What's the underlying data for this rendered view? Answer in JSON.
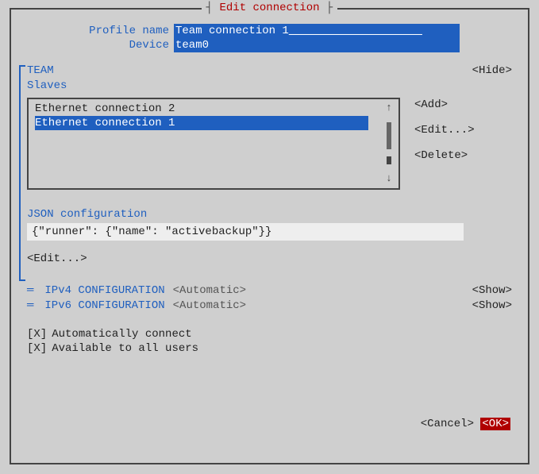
{
  "window_title": "Edit connection",
  "profile": {
    "label": "Profile name",
    "value": "Team connection 1",
    "pad": "____________________"
  },
  "device": {
    "label": "Device",
    "value": "team0",
    "pad": "                                       "
  },
  "team": {
    "label": "TEAM",
    "hide": "<Hide>",
    "slaves_label": "Slaves",
    "slaves": [
      {
        "name": "Ethernet connection 2",
        "selected": false
      },
      {
        "name": "Ethernet connection 1",
        "selected": true
      }
    ],
    "add": "<Add>",
    "edit": "<Edit...>",
    "del": "<Delete>",
    "json_label": "JSON configuration",
    "json_value": "{\"runner\": {\"name\": \"activebackup\"}}",
    "json_edit": "<Edit...>"
  },
  "ipv4": {
    "label": "IPv4 CONFIGURATION",
    "mode": "<Automatic>",
    "show": "<Show>"
  },
  "ipv6": {
    "label": "IPv6 CONFIGURATION",
    "mode": "<Automatic>",
    "show": "<Show>"
  },
  "auto_connect": {
    "mark": "[X]",
    "label": "Automatically connect"
  },
  "all_users": {
    "mark": "[X]",
    "label": "Available to all users"
  },
  "cancel": "<Cancel>",
  "ok": "<OK>"
}
